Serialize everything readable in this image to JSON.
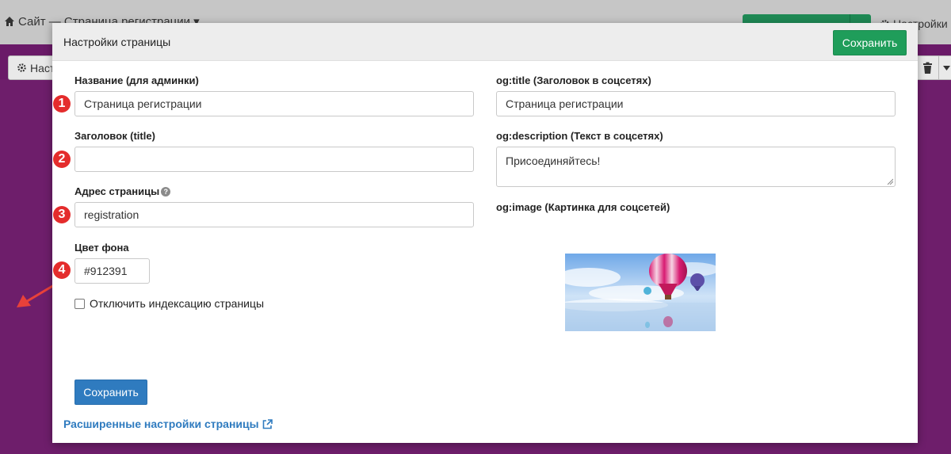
{
  "background": {
    "breadcrumb": "Сайт — Страница регистрации ▾",
    "settings_label": "Настройки",
    "left_button_label": "Наст",
    "accent_color": "#912391"
  },
  "modal": {
    "title": "Настройки страницы",
    "save_top_label": "Сохранить",
    "save_bottom_label": "Сохранить",
    "advanced_link": "Расширенные настройки страницы"
  },
  "form_left": {
    "name_label": "Название (для админки)",
    "name_value": "Страница регистрации",
    "title_label": "Заголовок (title)",
    "title_value": "",
    "address_label": "Адрес страницы",
    "address_value": "registration",
    "color_label": "Цвет фона",
    "color_value": "#912391",
    "noindex_label": "Отключить индексацию страницы",
    "noindex_checked": false
  },
  "form_right": {
    "og_title_label": "og:title (Заголовок в соцсетях)",
    "og_title_value": "Страница регистрации",
    "og_description_label": "og:description (Текст в соцсетях)",
    "og_description_value": "Присоединяйтесь!",
    "og_image_label": "og:image (Картинка для соцсетей)"
  },
  "annotations": {
    "numbers": [
      "1",
      "2",
      "3",
      "4"
    ],
    "color": "#e42c2c"
  }
}
